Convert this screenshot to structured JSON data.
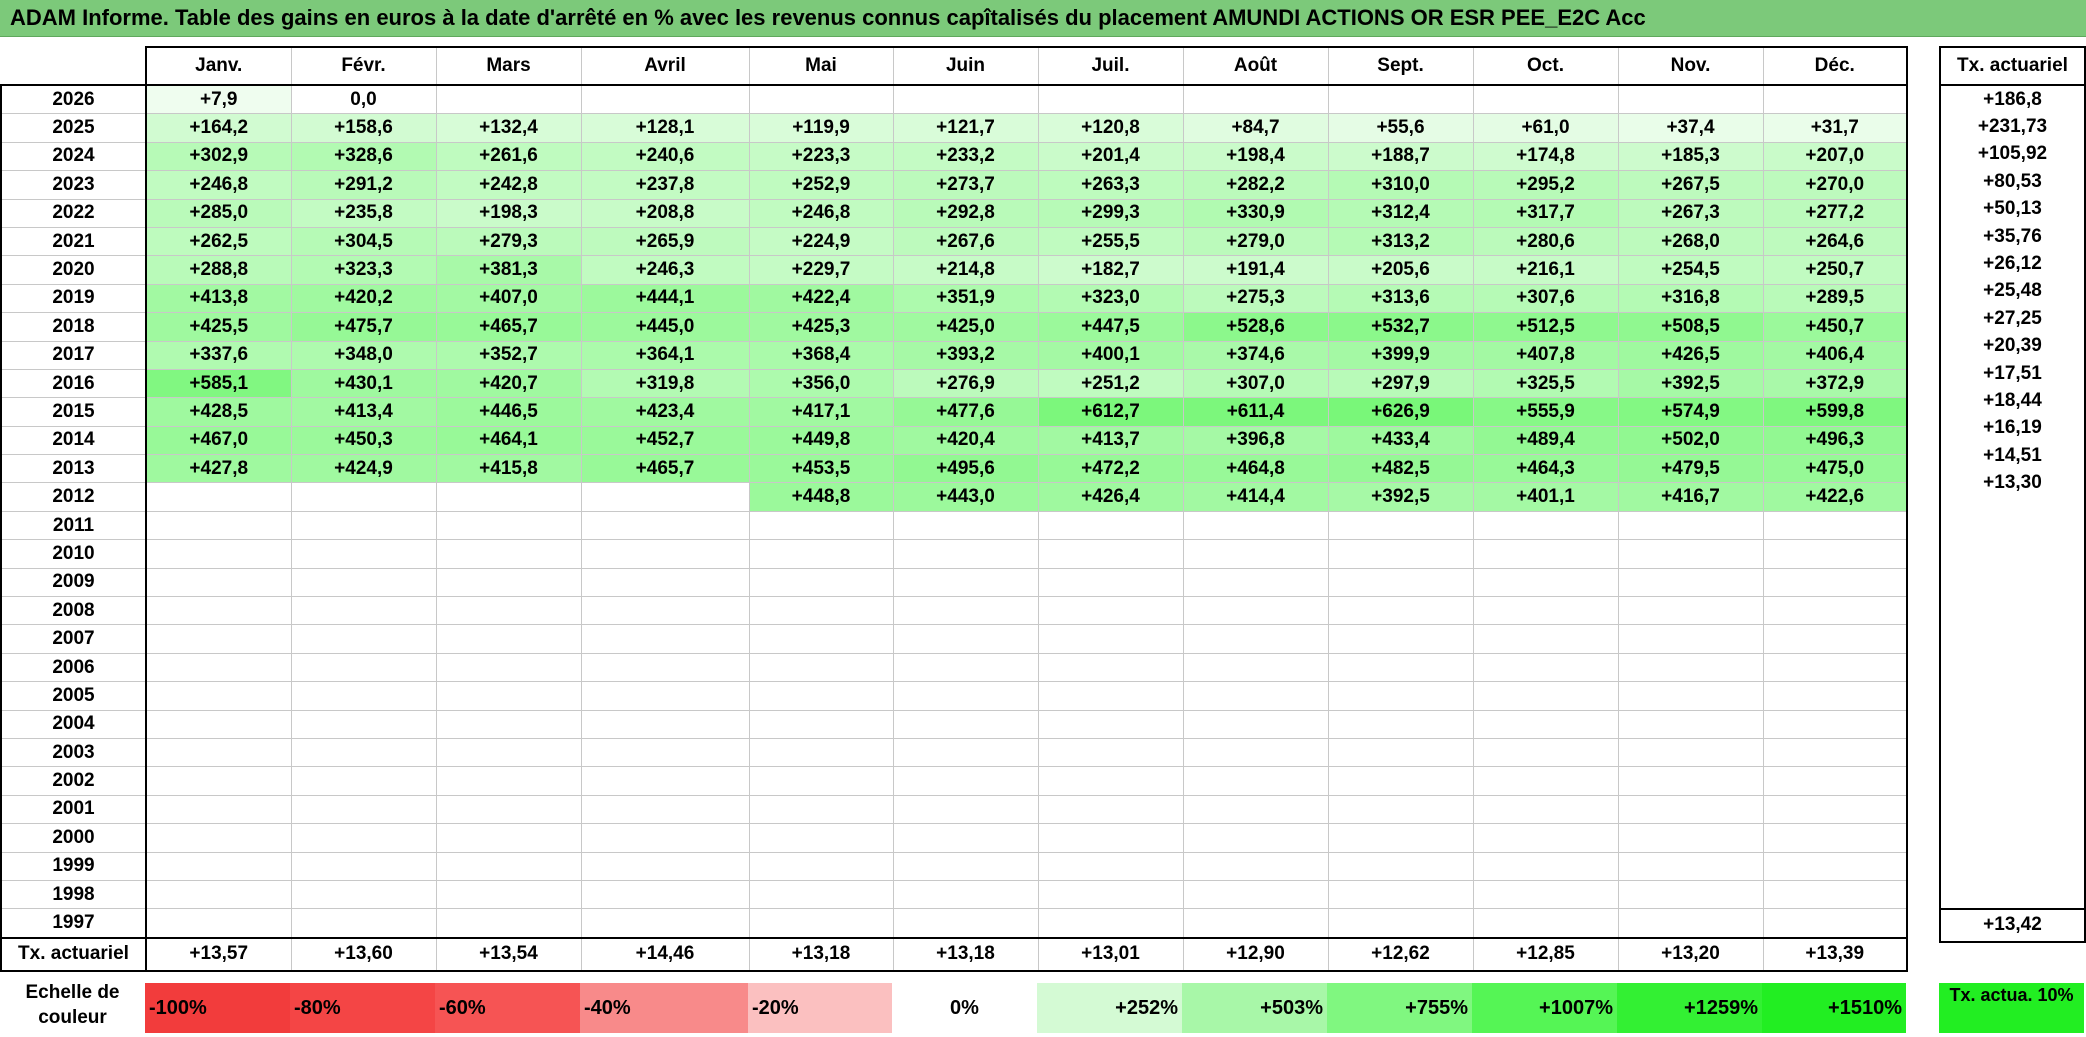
{
  "title": "ADAM Informe. Table des gains en euros à la date d'arrêté en % avec les revenus connus capîtalisés du placement AMUNDI ACTIONS OR ESR PEE_E2C Acc",
  "months": [
    "Janv.",
    "Févr.",
    "Mars",
    "Avril",
    "Mai",
    "Juin",
    "Juil.",
    "Août",
    "Sept.",
    "Oct.",
    "Nov.",
    "Déc."
  ],
  "actuarial_header": "Tx. actuariel",
  "rows": [
    {
      "year": "2026",
      "values": [
        "+7,9",
        "0,0",
        "",
        "",
        "",
        "",
        "",
        "",
        "",
        "",
        "",
        ""
      ],
      "rate": "+186,8"
    },
    {
      "year": "2025",
      "values": [
        "+164,2",
        "+158,6",
        "+132,4",
        "+128,1",
        "+119,9",
        "+121,7",
        "+120,8",
        "+84,7",
        "+55,6",
        "+61,0",
        "+37,4",
        "+31,7"
      ],
      "rate": "+231,73"
    },
    {
      "year": "2024",
      "values": [
        "+302,9",
        "+328,6",
        "+261,6",
        "+240,6",
        "+223,3",
        "+233,2",
        "+201,4",
        "+198,4",
        "+188,7",
        "+174,8",
        "+185,3",
        "+207,0"
      ],
      "rate": "+105,92"
    },
    {
      "year": "2023",
      "values": [
        "+246,8",
        "+291,2",
        "+242,8",
        "+237,8",
        "+252,9",
        "+273,7",
        "+263,3",
        "+282,2",
        "+310,0",
        "+295,2",
        "+267,5",
        "+270,0"
      ],
      "rate": "+80,53"
    },
    {
      "year": "2022",
      "values": [
        "+285,0",
        "+235,8",
        "+198,3",
        "+208,8",
        "+246,8",
        "+292,8",
        "+299,3",
        "+330,9",
        "+312,4",
        "+317,7",
        "+267,3",
        "+277,2"
      ],
      "rate": "+50,13"
    },
    {
      "year": "2021",
      "values": [
        "+262,5",
        "+304,5",
        "+279,3",
        "+265,9",
        "+224,9",
        "+267,6",
        "+255,5",
        "+279,0",
        "+313,2",
        "+280,6",
        "+268,0",
        "+264,6"
      ],
      "rate": "+35,76"
    },
    {
      "year": "2020",
      "values": [
        "+288,8",
        "+323,3",
        "+381,3",
        "+246,3",
        "+229,7",
        "+214,8",
        "+182,7",
        "+191,4",
        "+205,6",
        "+216,1",
        "+254,5",
        "+250,7"
      ],
      "rate": "+26,12"
    },
    {
      "year": "2019",
      "values": [
        "+413,8",
        "+420,2",
        "+407,0",
        "+444,1",
        "+422,4",
        "+351,9",
        "+323,0",
        "+275,3",
        "+313,6",
        "+307,6",
        "+316,8",
        "+289,5"
      ],
      "rate": "+25,48"
    },
    {
      "year": "2018",
      "values": [
        "+425,5",
        "+475,7",
        "+465,7",
        "+445,0",
        "+425,3",
        "+425,0",
        "+447,5",
        "+528,6",
        "+532,7",
        "+512,5",
        "+508,5",
        "+450,7"
      ],
      "rate": "+27,25"
    },
    {
      "year": "2017",
      "values": [
        "+337,6",
        "+348,0",
        "+352,7",
        "+364,1",
        "+368,4",
        "+393,2",
        "+400,1",
        "+374,6",
        "+399,9",
        "+407,8",
        "+426,5",
        "+406,4"
      ],
      "rate": "+20,39"
    },
    {
      "year": "2016",
      "values": [
        "+585,1",
        "+430,1",
        "+420,7",
        "+319,8",
        "+356,0",
        "+276,9",
        "+251,2",
        "+307,0",
        "+297,9",
        "+325,5",
        "+392,5",
        "+372,9"
      ],
      "rate": "+17,51"
    },
    {
      "year": "2015",
      "values": [
        "+428,5",
        "+413,4",
        "+446,5",
        "+423,4",
        "+417,1",
        "+477,6",
        "+612,7",
        "+611,4",
        "+626,9",
        "+555,9",
        "+574,9",
        "+599,8"
      ],
      "rate": "+18,44"
    },
    {
      "year": "2014",
      "values": [
        "+467,0",
        "+450,3",
        "+464,1",
        "+452,7",
        "+449,8",
        "+420,4",
        "+413,7",
        "+396,8",
        "+433,4",
        "+489,4",
        "+502,0",
        "+496,3"
      ],
      "rate": "+16,19"
    },
    {
      "year": "2013",
      "values": [
        "+427,8",
        "+424,9",
        "+415,8",
        "+465,7",
        "+453,5",
        "+495,6",
        "+472,2",
        "+464,8",
        "+482,5",
        "+464,3",
        "+479,5",
        "+475,0"
      ],
      "rate": "+14,51"
    },
    {
      "year": "2012",
      "values": [
        "",
        "",
        "",
        "",
        "+448,8",
        "+443,0",
        "+426,4",
        "+414,4",
        "+392,5",
        "+401,1",
        "+416,7",
        "+422,6"
      ],
      "rate": "+13,30"
    },
    {
      "year": "2011",
      "values": [
        "",
        "",
        "",
        "",
        "",
        "",
        "",
        "",
        "",
        "",
        "",
        ""
      ],
      "rate": ""
    },
    {
      "year": "2010",
      "values": [
        "",
        "",
        "",
        "",
        "",
        "",
        "",
        "",
        "",
        "",
        "",
        ""
      ],
      "rate": ""
    },
    {
      "year": "2009",
      "values": [
        "",
        "",
        "",
        "",
        "",
        "",
        "",
        "",
        "",
        "",
        "",
        ""
      ],
      "rate": ""
    },
    {
      "year": "2008",
      "values": [
        "",
        "",
        "",
        "",
        "",
        "",
        "",
        "",
        "",
        "",
        "",
        ""
      ],
      "rate": ""
    },
    {
      "year": "2007",
      "values": [
        "",
        "",
        "",
        "",
        "",
        "",
        "",
        "",
        "",
        "",
        "",
        ""
      ],
      "rate": ""
    },
    {
      "year": "2006",
      "values": [
        "",
        "",
        "",
        "",
        "",
        "",
        "",
        "",
        "",
        "",
        "",
        ""
      ],
      "rate": ""
    },
    {
      "year": "2005",
      "values": [
        "",
        "",
        "",
        "",
        "",
        "",
        "",
        "",
        "",
        "",
        "",
        ""
      ],
      "rate": ""
    },
    {
      "year": "2004",
      "values": [
        "",
        "",
        "",
        "",
        "",
        "",
        "",
        "",
        "",
        "",
        "",
        ""
      ],
      "rate": ""
    },
    {
      "year": "2003",
      "values": [
        "",
        "",
        "",
        "",
        "",
        "",
        "",
        "",
        "",
        "",
        "",
        ""
      ],
      "rate": ""
    },
    {
      "year": "2002",
      "values": [
        "",
        "",
        "",
        "",
        "",
        "",
        "",
        "",
        "",
        "",
        "",
        ""
      ],
      "rate": ""
    },
    {
      "year": "2001",
      "values": [
        "",
        "",
        "",
        "",
        "",
        "",
        "",
        "",
        "",
        "",
        "",
        ""
      ],
      "rate": ""
    },
    {
      "year": "2000",
      "values": [
        "",
        "",
        "",
        "",
        "",
        "",
        "",
        "",
        "",
        "",
        "",
        ""
      ],
      "rate": ""
    },
    {
      "year": "1999",
      "values": [
        "",
        "",
        "",
        "",
        "",
        "",
        "",
        "",
        "",
        "",
        "",
        ""
      ],
      "rate": ""
    },
    {
      "year": "1998",
      "values": [
        "",
        "",
        "",
        "",
        "",
        "",
        "",
        "",
        "",
        "",
        "",
        ""
      ],
      "rate": ""
    },
    {
      "year": "1997",
      "values": [
        "",
        "",
        "",
        "",
        "",
        "",
        "",
        "",
        "",
        "",
        "",
        ""
      ],
      "rate": ""
    }
  ],
  "footer": {
    "label": "Tx. actuariel",
    "values": [
      "+13,57",
      "+13,60",
      "+13,54",
      "+14,46",
      "+13,18",
      "+13,18",
      "+13,01",
      "+12,90",
      "+12,62",
      "+12,85",
      "+13,20",
      "+13,39"
    ],
    "rate": "+13,42"
  },
  "scale": {
    "label": "Echelle de couleur",
    "items": [
      {
        "text": "-100%",
        "color": "#f23c3c"
      },
      {
        "text": "-80%",
        "color": "#f44545"
      },
      {
        "text": "-60%",
        "color": "#f65454"
      },
      {
        "text": "-40%",
        "color": "#f88a8a"
      },
      {
        "text": "-20%",
        "color": "#fbc0c0"
      },
      {
        "text": "0%",
        "color": "#ffffff"
      },
      {
        "text": "+252%",
        "color": "#d4fad4"
      },
      {
        "text": "+503%",
        "color": "#a8f7a8"
      },
      {
        "text": "+755%",
        "color": "#80f780"
      },
      {
        "text": "+1007%",
        "color": "#55f555"
      },
      {
        "text": "+1259%",
        "color": "#33f033"
      },
      {
        "text": "+1510%",
        "color": "#22ee22"
      }
    ],
    "actuarial_swatch": "Tx. actua. 10%",
    "actuarial_color": "#22ee22"
  },
  "colors": {
    "title_bg": "#7cc97a",
    "scale_max_value": 1510
  }
}
